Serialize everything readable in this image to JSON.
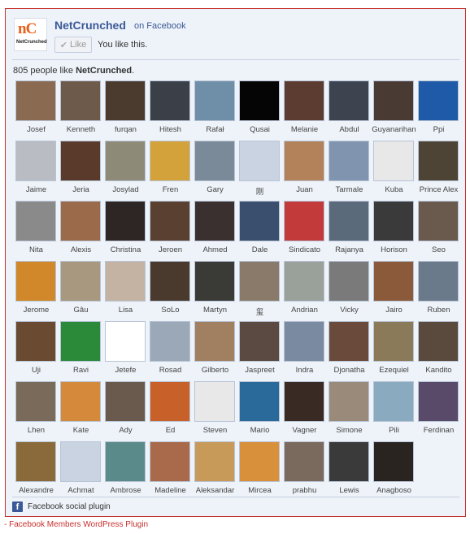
{
  "header": {
    "page_name": "NetCrunched",
    "on_facebook": "on Facebook",
    "like_label": "Like",
    "you_like": "You like this.",
    "logo_text": "nC",
    "logo_sub": "NetCrunched"
  },
  "count": {
    "number_text": "805 people like",
    "page_name": "NetCrunched",
    "suffix": "."
  },
  "members": [
    {
      "name": "Josef",
      "color": "#8a6a50"
    },
    {
      "name": "Kenneth",
      "color": "#6d5a4a"
    },
    {
      "name": "furqan",
      "color": "#4b3a2e"
    },
    {
      "name": "Hitesh",
      "color": "#3a3f48"
    },
    {
      "name": "Rafał",
      "color": "#6f8fa8"
    },
    {
      "name": "Qusai",
      "color": "#050505"
    },
    {
      "name": "Melanie",
      "color": "#5c3b30"
    },
    {
      "name": "Abdul",
      "color": "#3d4450"
    },
    {
      "name": "Guyanarihan",
      "color": "#4a3a34"
    },
    {
      "name": "Ppi",
      "color": "#1f5aa8"
    },
    {
      "name": "Jaime",
      "color": "#b9bcc2"
    },
    {
      "name": "Jeria",
      "color": "#5a3a2a"
    },
    {
      "name": "Josylad",
      "color": "#8e8a78"
    },
    {
      "name": "Fren",
      "color": "#d4a23a"
    },
    {
      "name": "Gary",
      "color": "#7a8a98"
    },
    {
      "name": "刚",
      "color": "#c9d3e2"
    },
    {
      "name": "Juan",
      "color": "#b3825a"
    },
    {
      "name": "Tarmale",
      "color": "#8094b0"
    },
    {
      "name": "Kuba",
      "color": "#e8e8e8"
    },
    {
      "name": "Prince Alex",
      "color": "#4e4436"
    },
    {
      "name": "Nita",
      "color": "#8a8a8a"
    },
    {
      "name": "Alexis",
      "color": "#9a6a4a"
    },
    {
      "name": "Christina",
      "color": "#2e2624"
    },
    {
      "name": "Jeroen",
      "color": "#5a4030"
    },
    {
      "name": "Ahmed",
      "color": "#3a3030"
    },
    {
      "name": "Dale",
      "color": "#3a4e6e"
    },
    {
      "name": "Sindicato",
      "color": "#c23a3a"
    },
    {
      "name": "Rajanya",
      "color": "#5a6a7a"
    },
    {
      "name": "Horison",
      "color": "#3a3a3a"
    },
    {
      "name": "Seo",
      "color": "#6a5a4e"
    },
    {
      "name": "Jerome",
      "color": "#d0882a"
    },
    {
      "name": "Gâu",
      "color": "#a89880"
    },
    {
      "name": "Lisa",
      "color": "#c4b2a2"
    },
    {
      "name": "SoLo",
      "color": "#4a3a2e"
    },
    {
      "name": "Martyn",
      "color": "#3a3a36"
    },
    {
      "name": "玺",
      "color": "#8a7a6a"
    },
    {
      "name": "Andrian",
      "color": "#9aa09a"
    },
    {
      "name": "Vicky",
      "color": "#7a7a7a"
    },
    {
      "name": "Jairo",
      "color": "#8a5a3a"
    },
    {
      "name": "Ruben",
      "color": "#6a7a8a"
    },
    {
      "name": "Uji",
      "color": "#6a4a30"
    },
    {
      "name": "Ravi",
      "color": "#2a8a3a"
    },
    {
      "name": "Jetefe",
      "color": "#ffffff"
    },
    {
      "name": "Rosad",
      "color": "#9aa8b8"
    },
    {
      "name": "Gilberto",
      "color": "#a08060"
    },
    {
      "name": "Jaspreet",
      "color": "#5a4a42"
    },
    {
      "name": "Indra",
      "color": "#7a8aa0"
    },
    {
      "name": "Djonatha",
      "color": "#6a4a3a"
    },
    {
      "name": "Ezequiel",
      "color": "#8a7a5a"
    },
    {
      "name": "Kandito",
      "color": "#5a4a3e"
    },
    {
      "name": "Lhen",
      "color": "#7a6a5a"
    },
    {
      "name": "Kate",
      "color": "#d48a3a"
    },
    {
      "name": "Ady",
      "color": "#6a5a4e"
    },
    {
      "name": "Ed",
      "color": "#c8602a"
    },
    {
      "name": "Steven",
      "color": "#e8e8e8"
    },
    {
      "name": "Mario",
      "color": "#2a6a9a"
    },
    {
      "name": "Vagner",
      "color": "#3a2a24"
    },
    {
      "name": "Simone",
      "color": "#9a8a7a"
    },
    {
      "name": "Pili",
      "color": "#8aaac0"
    },
    {
      "name": "Ferdinan",
      "color": "#5a4a6a"
    },
    {
      "name": "Alexandre",
      "color": "#8a6a3a"
    },
    {
      "name": "Achmat",
      "color": "#c9d3e2"
    },
    {
      "name": "Ambrose",
      "color": "#5a8a8a"
    },
    {
      "name": "Madeline",
      "color": "#a86a4a"
    },
    {
      "name": "Aleksandar",
      "color": "#c89a5a"
    },
    {
      "name": "Mircea",
      "color": "#d8903a"
    },
    {
      "name": "prabhu",
      "color": "#7a6a5e"
    },
    {
      "name": "Lewis",
      "color": "#3a3a3a"
    },
    {
      "name": "Anagboso",
      "color": "#2a2420"
    }
  ],
  "footer": {
    "plugin_label": "Facebook social plugin",
    "fb_letter": "f"
  },
  "wp_link": "- Facebook Members WordPress Plugin"
}
